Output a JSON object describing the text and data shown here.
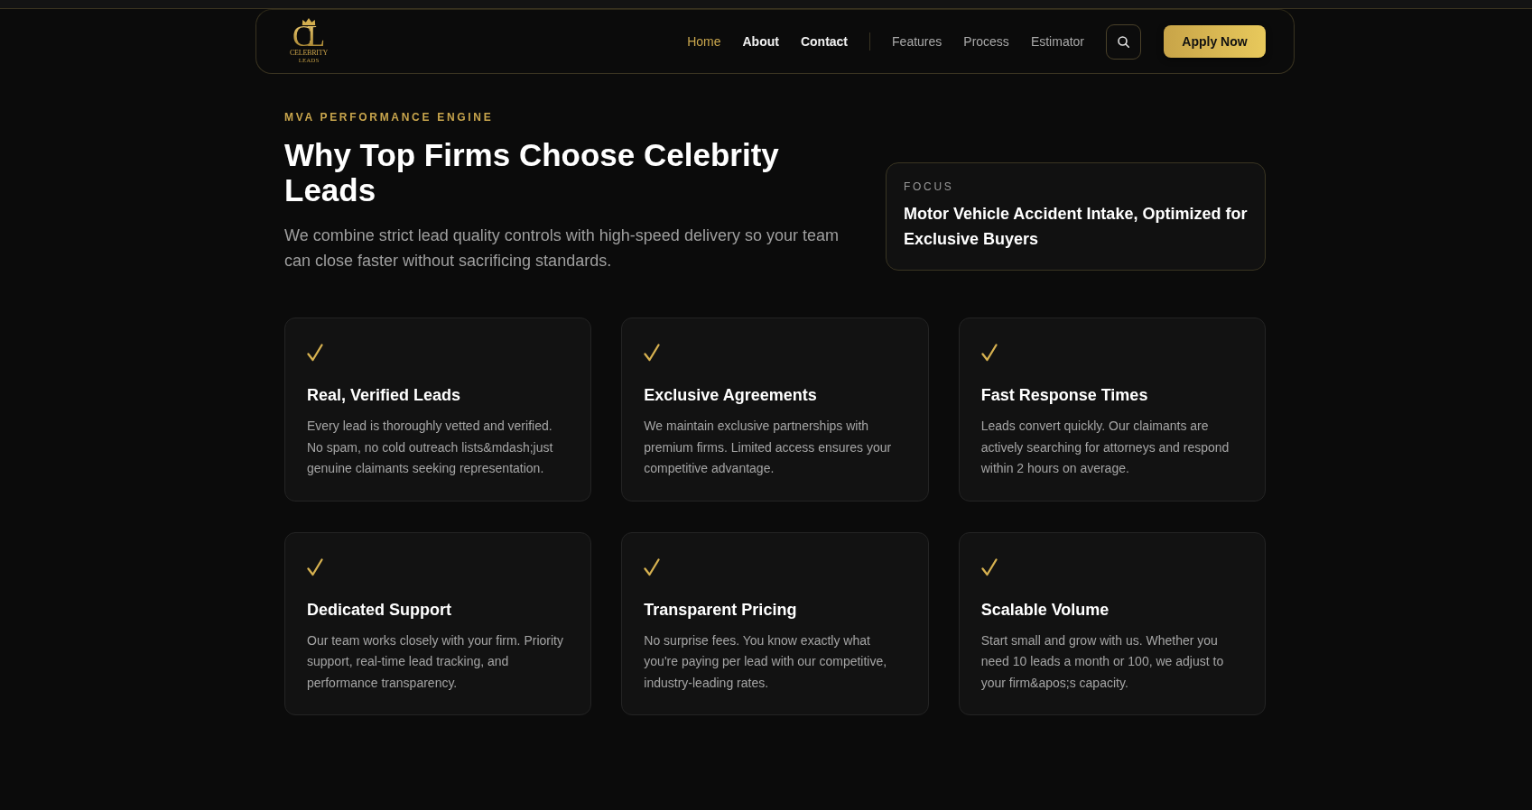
{
  "header": {
    "logo": {
      "monogram": "CL",
      "wordmark": "CELEBRITY",
      "tagline": "LEADS"
    },
    "primary_links": [
      {
        "label": "Home",
        "selected": true
      },
      {
        "label": "About",
        "selected": false
      },
      {
        "label": "Contact",
        "selected": false
      }
    ],
    "secondary_links": [
      {
        "label": "Features",
        "selected": false
      },
      {
        "label": "Process",
        "selected": false
      },
      {
        "label": "Estimator",
        "selected": false
      }
    ],
    "cta_button": "Apply Now"
  },
  "hero": {
    "eyebrow": "MVA PERFORMANCE ENGINE",
    "title": "Why Top Firms Choose Celebrity Leads",
    "description": "We combine strict lead quality controls with high-speed delivery so your team can close faster without sacrificing standards.",
    "focus_card": {
      "label": "FOCUS",
      "text": "Motor Vehicle Accident Intake, Optimized for Exclusive Buyers"
    }
  },
  "features": [
    {
      "title": "Real, Verified Leads",
      "description": "Every lead is thoroughly vetted and verified. No spam, no cold outreach lists&mdash;just genuine claimants seeking representation."
    },
    {
      "title": "Exclusive Agreements",
      "description": "We maintain exclusive partnerships with premium firms. Limited access ensures your competitive advantage."
    },
    {
      "title": "Fast Response Times",
      "description": "Leads convert quickly. Our claimants are actively searching for attorneys and respond within 2 hours on average."
    },
    {
      "title": "Dedicated Support",
      "description": "Our team works closely with your firm. Priority support, real-time lead tracking, and performance transparency."
    },
    {
      "title": "Transparent Pricing",
      "description": "No surprise fees. You know exactly what you're paying per lead with our competitive, industry-leading rates."
    },
    {
      "title": "Scalable Volume",
      "description": "Start small and grow with us. Whether you need 10 leads a month or 100, we adjust to your firm&apos;s capacity."
    }
  ]
}
